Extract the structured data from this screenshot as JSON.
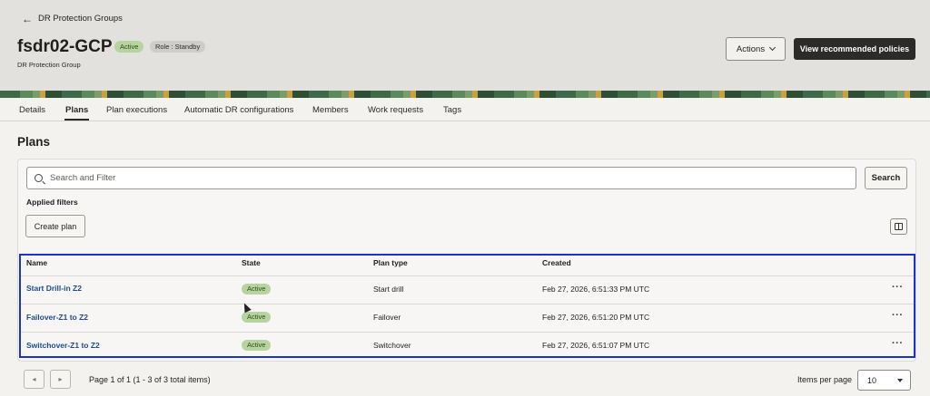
{
  "header": {
    "back_label": "DR Protection Groups",
    "title": "fsdr02-GCP",
    "status_badge": "Active",
    "role_badge": "Role : Standby",
    "subtitle": "DR Protection Group",
    "actions_label": "Actions",
    "view_policies_label": "View recommended policies"
  },
  "tabs": [
    {
      "label": "Details"
    },
    {
      "label": "Plans",
      "active": true
    },
    {
      "label": "Plan executions"
    },
    {
      "label": "Automatic DR configurations"
    },
    {
      "label": "Members"
    },
    {
      "label": "Work requests"
    },
    {
      "label": "Tags"
    }
  ],
  "section": {
    "title": "Plans"
  },
  "search": {
    "placeholder": "Search and Filter",
    "value": "",
    "button_label": "Search"
  },
  "filters": {
    "applied_label": "Applied filters"
  },
  "create_plan_label": "Create plan",
  "table": {
    "columns": [
      "Name",
      "State",
      "Plan type",
      "Created"
    ],
    "rows": [
      {
        "name": "Start Drill-in Z2",
        "state": "Active",
        "plan_type": "Start drill",
        "created": "Feb 27, 2026, 6:51:33 PM UTC",
        "menu": "···"
      },
      {
        "name": "Failover-Z1 to Z2",
        "state": "Active",
        "plan_type": "Failover",
        "created": "Feb 27, 2026, 6:51:20 PM UTC",
        "menu": "···"
      },
      {
        "name": "Switchover-Z1 to Z2",
        "state": "Active",
        "plan_type": "Switchover",
        "created": "Feb 27, 2026, 6:51:07 PM UTC",
        "menu": "···"
      }
    ]
  },
  "pagination": {
    "prev_glyph": "◂",
    "next_glyph": "▸",
    "summary": "Page 1 of 1 (1 - 3 of 3 total items)",
    "items_per_page_label": "Items per page",
    "items_per_page_value": "10"
  },
  "icons": {
    "back": "arrow-left-icon",
    "search": "search-icon",
    "columns": "columns-icon",
    "actions_chevron": "chevron-down-icon",
    "row_menu": "more-horizontal-icon"
  },
  "colors": {
    "primary_button": "#2d2b29",
    "active_badge": "#b7d49f",
    "link": "#1e4c8a",
    "highlight_frame": "#1b34c8"
  }
}
